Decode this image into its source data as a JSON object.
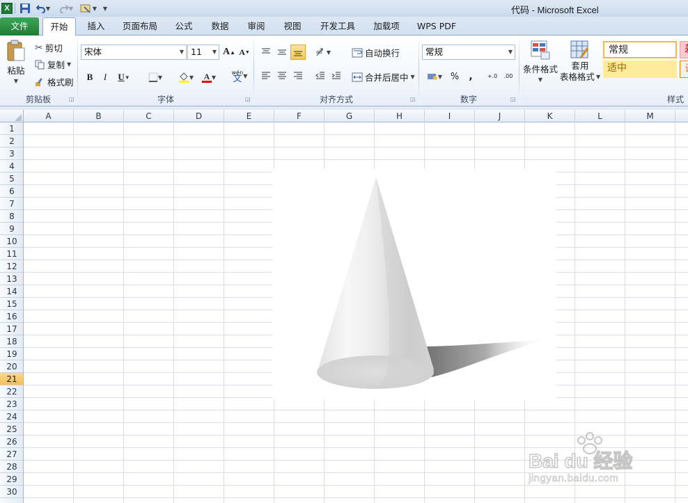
{
  "window": {
    "title": "代码 - Microsoft Excel",
    "app_icon_letter": "X"
  },
  "tabs": [
    {
      "label": "文件",
      "active": false
    },
    {
      "label": "开始",
      "active": true
    },
    {
      "label": "插入",
      "active": false
    },
    {
      "label": "页面布局",
      "active": false
    },
    {
      "label": "公式",
      "active": false
    },
    {
      "label": "数据",
      "active": false
    },
    {
      "label": "审阅",
      "active": false
    },
    {
      "label": "视图",
      "active": false
    },
    {
      "label": "开发工具",
      "active": false
    },
    {
      "label": "加载项",
      "active": false
    },
    {
      "label": "WPS PDF",
      "active": false
    }
  ],
  "ribbon": {
    "clipboard": {
      "paste_label": "粘贴",
      "cut_label": "剪切",
      "copy_label": "复制",
      "format_painter_label": "格式刷",
      "group_label": "剪贴板"
    },
    "font": {
      "font_name": "宋体",
      "font_size": "11",
      "bold": "B",
      "italic": "I",
      "underline": "U",
      "font_color_letter": "A",
      "phonetic": "wén",
      "phonetic_char": "文",
      "grow_letter": "A",
      "shrink_letter": "A",
      "group_label": "字体"
    },
    "alignment": {
      "wrap_text_label": "自动换行",
      "merge_center_label": "合并后居中",
      "group_label": "对齐方式"
    },
    "number": {
      "format_value": "常规",
      "percent": "%",
      "comma": ",",
      "inc_decimal": "+.0",
      "dec_decimal": ".00",
      "group_label": "数字"
    },
    "styles": {
      "conditional_format_label": "条件格式",
      "table_format_label_line1": "套用",
      "table_format_label_line2": "表格格式",
      "style_normal": "常规",
      "style_neutral": "适中",
      "style_bad_partial": "差",
      "style_calc_partial": "计",
      "group_label": "样式"
    }
  },
  "sheet": {
    "columns": [
      "A",
      "B",
      "C",
      "D",
      "E",
      "F",
      "G",
      "H",
      "I",
      "J",
      "K",
      "L",
      "M"
    ],
    "rows": [
      "1",
      "2",
      "3",
      "4",
      "5",
      "6",
      "7",
      "8",
      "9",
      "10",
      "11",
      "12",
      "13",
      "14",
      "15",
      "16",
      "17",
      "18",
      "19",
      "20",
      "21",
      "22",
      "23",
      "24",
      "25",
      "26",
      "27",
      "28",
      "29",
      "30"
    ],
    "active_row": "21"
  },
  "watermark": {
    "brand": "Bai du 经验",
    "url": "jingyan.baidu.com"
  },
  "colors": {
    "file_tab": "#1e7d34",
    "active_row_header": "#f1c05c",
    "neutral_style_bg": "#ffeb9c",
    "ribbon_border": "#8ea8c9"
  }
}
